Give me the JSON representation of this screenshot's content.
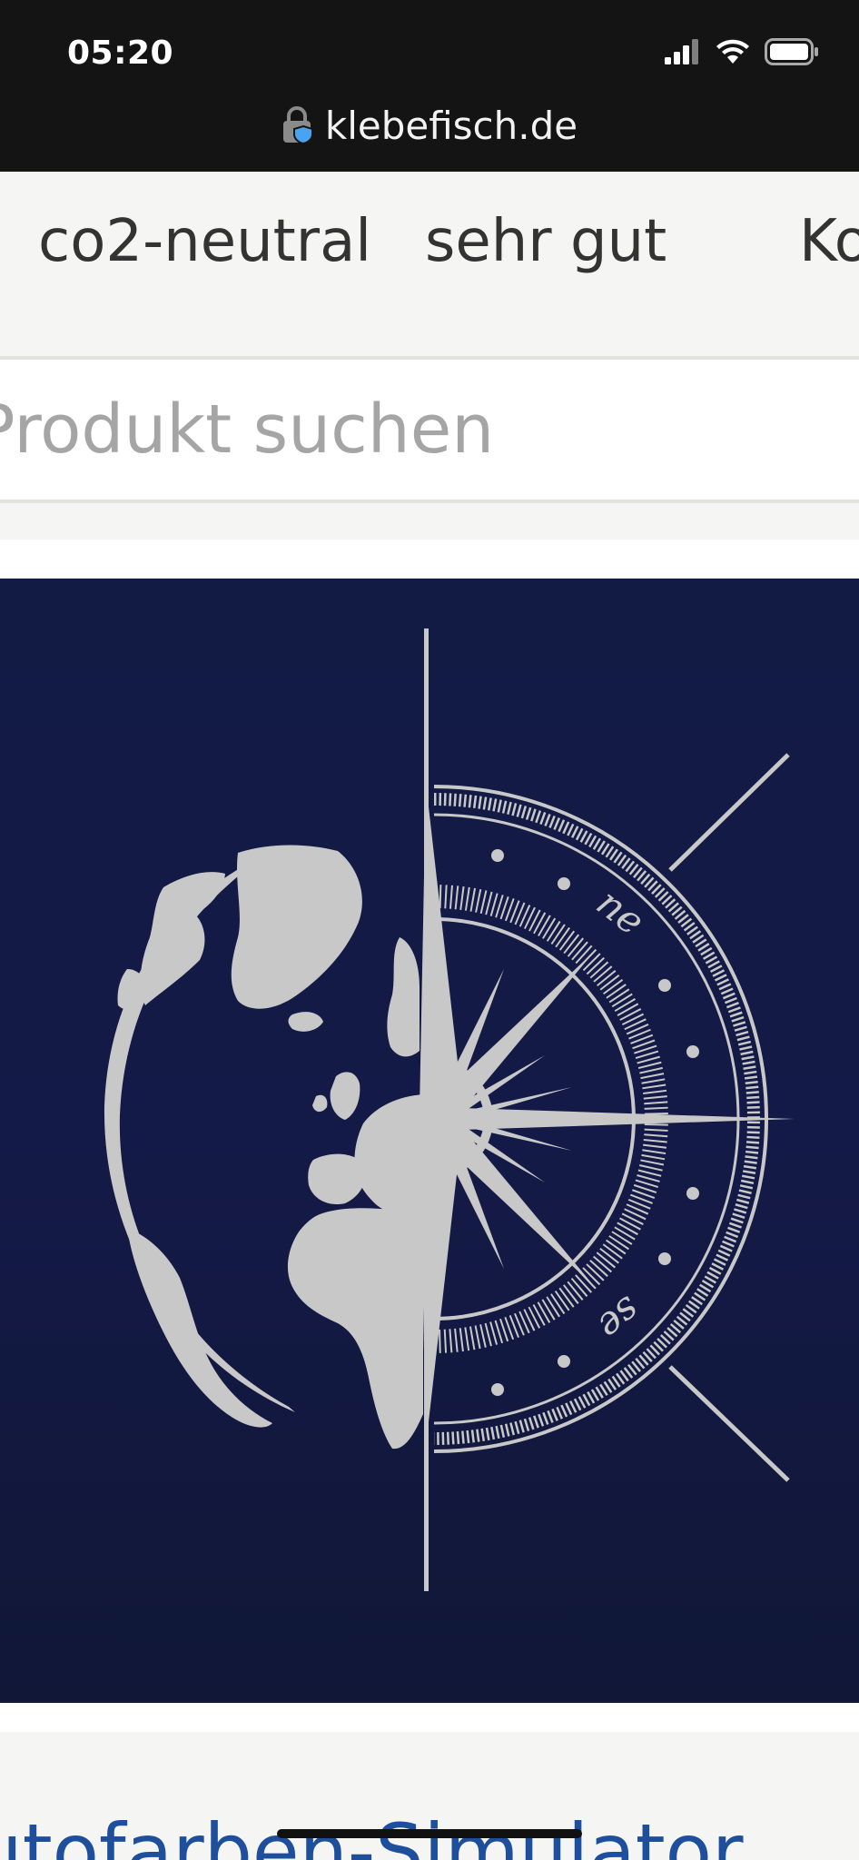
{
  "status_bar": {
    "time": "05:20",
    "signal_icon": "signal-bars-icon",
    "wifi_icon": "wifi-icon",
    "battery_icon": "battery-icon"
  },
  "browser": {
    "url": "klebefisch.de",
    "lock_icon": "lock-shield-icon"
  },
  "trust_bar": {
    "items": [
      "co2-neutral",
      "sehr gut",
      "Ko"
    ]
  },
  "search": {
    "placeholder": "Produkt suchen"
  },
  "hero": {
    "compass_labels": [
      "ne",
      "se"
    ],
    "colors": {
      "background": "#131b45",
      "artwork": "#c8c8c8"
    }
  },
  "simulator": {
    "link_text": "Autofarben-Simulator",
    "color": "#1d4f9c"
  }
}
